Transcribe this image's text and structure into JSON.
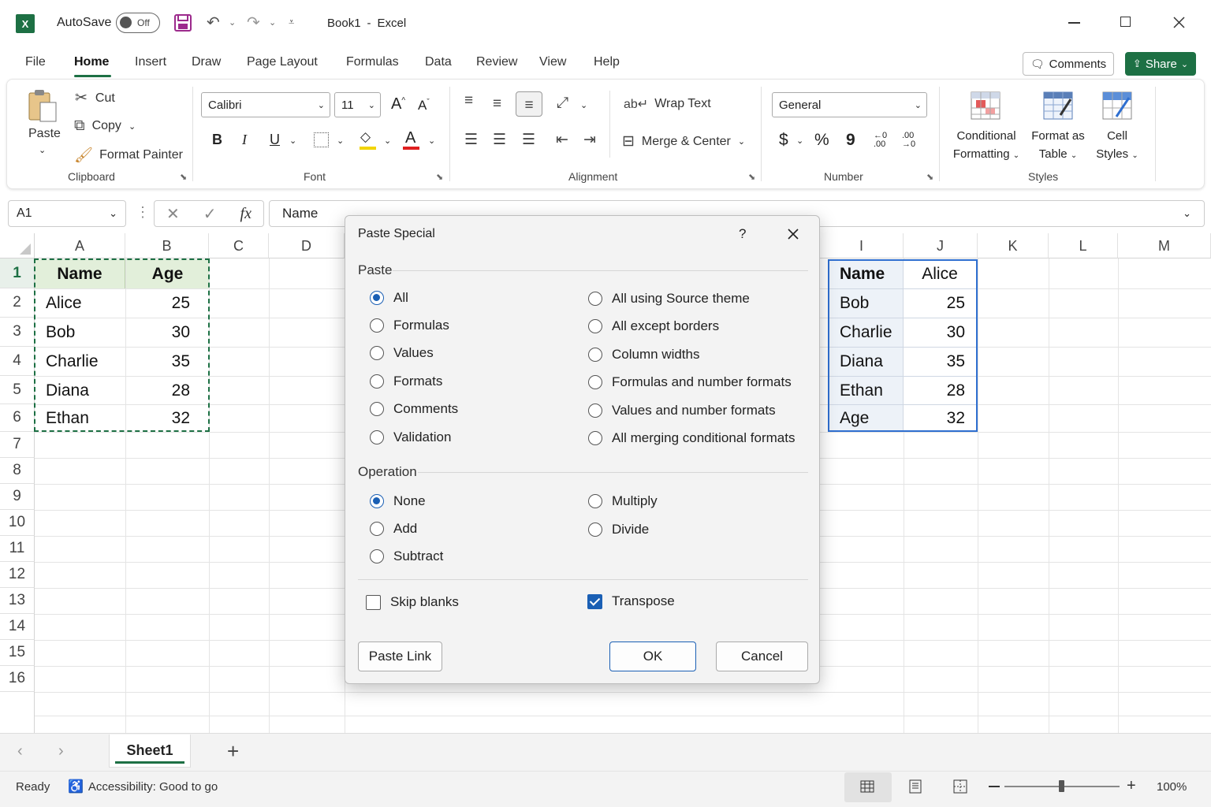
{
  "titlebar": {
    "app_logo": "X",
    "autosave_label": "AutoSave",
    "autosave_state": "Off",
    "document": "Book1",
    "separator": "-",
    "app_name": "Excel"
  },
  "tabs": [
    "File",
    "Home",
    "Insert",
    "Draw",
    "Page Layout",
    "Formulas",
    "Data",
    "Review",
    "View",
    "Help"
  ],
  "actions": {
    "comments": "Comments",
    "share": "Share"
  },
  "ribbon": {
    "clipboard": {
      "paste": "Paste",
      "cut": "Cut",
      "copy": "Copy",
      "format_painter": "Format Painter",
      "label": "Clipboard"
    },
    "font": {
      "name": "Calibri",
      "size": "11",
      "bold": "B",
      "italic": "I",
      "underline": "U",
      "grow": "A",
      "shrink": "A",
      "font_color": "A",
      "label": "Font"
    },
    "alignment": {
      "wrap_text": "Wrap Text",
      "merge_center": "Merge & Center",
      "label": "Alignment"
    },
    "number": {
      "format": "General",
      "currency": "$",
      "percent": "%",
      "comma": "9",
      "inc_decimal": "←0 .00",
      "dec_decimal": ".00 →0",
      "label": "Number"
    },
    "styles": {
      "conditional_1": "Conditional",
      "conditional_2": "Formatting",
      "format_table_1": "Format as",
      "format_table_2": "Table",
      "cell_styles_1": "Cell",
      "cell_styles_2": "Styles",
      "label": "Styles"
    }
  },
  "formula_bar": {
    "name_box": "A1",
    "fx": "fx",
    "content": "Name"
  },
  "columns": [
    "A",
    "B",
    "C",
    "D",
    "I",
    "J",
    "K",
    "L",
    "M"
  ],
  "rows": [
    "1",
    "2",
    "3",
    "4",
    "5",
    "6",
    "7",
    "8",
    "9",
    "10",
    "11",
    "12",
    "13",
    "14",
    "15",
    "16"
  ],
  "source_table": {
    "headers": [
      "Name",
      "Age"
    ],
    "rows": [
      [
        "Alice",
        "25"
      ],
      [
        "Bob",
        "30"
      ],
      [
        "Charlie",
        "35"
      ],
      [
        "Diana",
        "28"
      ],
      [
        "Ethan",
        "32"
      ]
    ]
  },
  "transposed_table": {
    "rows": [
      [
        "Name",
        "Alice"
      ],
      [
        "Bob",
        "25"
      ],
      [
        "Charlie",
        "30"
      ],
      [
        "Diana",
        "35"
      ],
      [
        "Ethan",
        "28"
      ],
      [
        "Age",
        "32"
      ]
    ]
  },
  "dialog": {
    "title": "Paste Special",
    "help": "?",
    "paste_section": "Paste",
    "paste_left": [
      "All",
      "Formulas",
      "Values",
      "Formats",
      "Comments",
      "Validation"
    ],
    "paste_right": [
      "All using Source theme",
      "All except borders",
      "Column widths",
      "Formulas and number formats",
      "Values and number formats",
      "All merging conditional formats"
    ],
    "paste_selected": "All",
    "operation_section": "Operation",
    "op_left": [
      "None",
      "Add",
      "Subtract"
    ],
    "op_right": [
      "Multiply",
      "Divide"
    ],
    "op_selected": "None",
    "skip_blanks": "Skip blanks",
    "skip_blanks_checked": false,
    "transpose": "Transpose",
    "transpose_checked": true,
    "paste_link": "Paste Link",
    "ok": "OK",
    "cancel": "Cancel"
  },
  "sheets": {
    "active": "Sheet1",
    "add": "+"
  },
  "status": {
    "ready": "Ready",
    "accessibility": "Accessibility: Good to go",
    "zoom": "100%"
  },
  "colors": {
    "excel_green": "#1d7044",
    "selection_dash": "#1d7044",
    "transposed_border": "#2f6fd0",
    "header_fill": "#e2efda",
    "accent_blue": "#1a5fb4"
  }
}
